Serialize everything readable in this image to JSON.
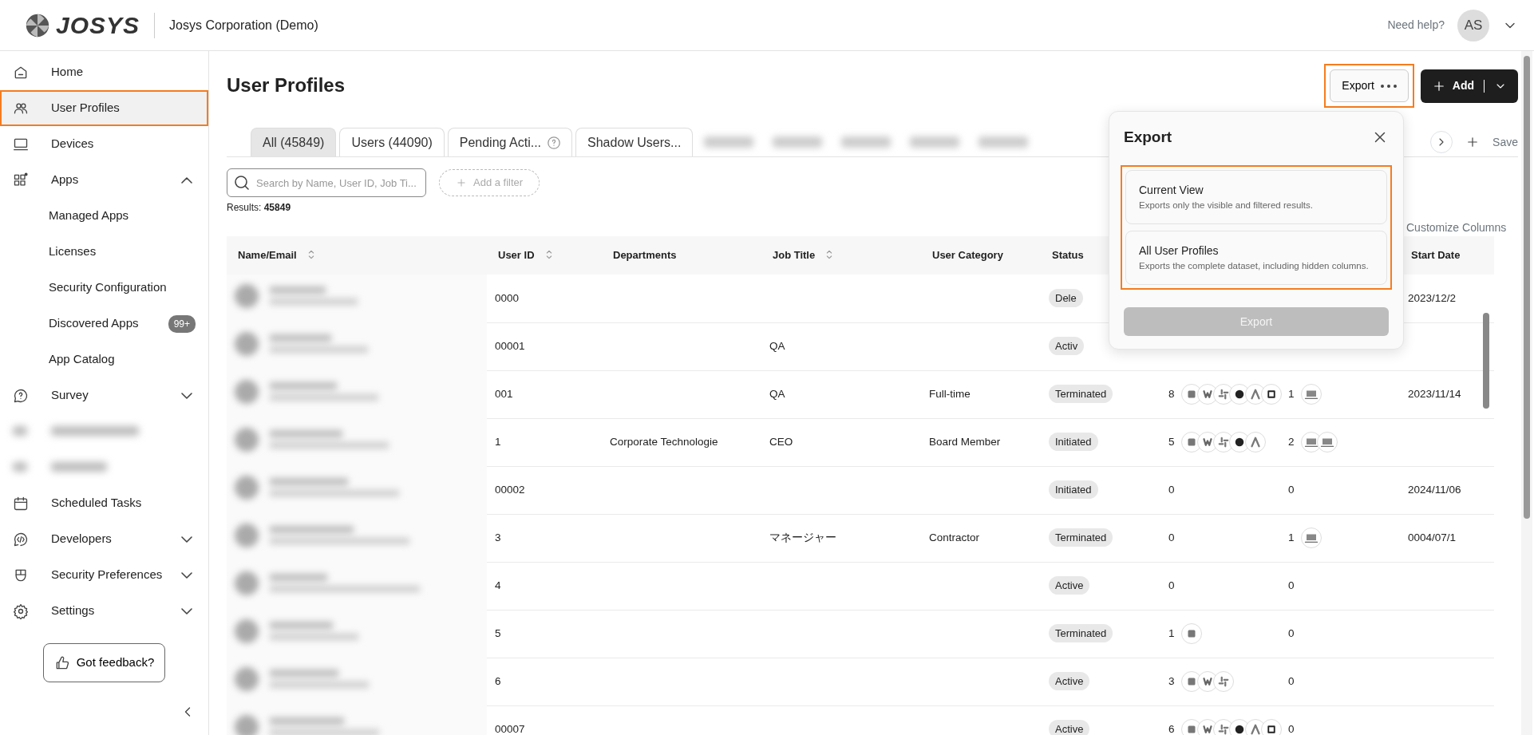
{
  "header": {
    "logo": "JOSYS",
    "organization": "Josys Corporation (Demo)",
    "help": "Need help?",
    "avatar": "AS"
  },
  "sidebar": {
    "items": [
      {
        "label": "Home",
        "selected": false
      },
      {
        "label": "User Profiles",
        "selected": true,
        "highlighted": true
      },
      {
        "label": "Devices",
        "selected": false
      },
      {
        "label": "Apps",
        "selected": false,
        "expanded": true,
        "children": [
          {
            "label": "Managed Apps",
            "selected": false
          },
          {
            "label": "Licenses",
            "selected": false
          },
          {
            "label": "Security Configuration",
            "selected": false
          },
          {
            "label": "Discovered Apps",
            "selected": false,
            "badge": "99+"
          },
          {
            "label": "App Catalog",
            "selected": false
          }
        ]
      },
      {
        "label": "Survey",
        "selected": false,
        "expanded": false
      },
      {
        "kind": "redacted"
      },
      {
        "kind": "redacted"
      },
      {
        "label": "Scheduled Tasks",
        "selected": false
      },
      {
        "label": "Developers",
        "selected": false,
        "expanded": false
      },
      {
        "label": "Security Preferences",
        "selected": false,
        "expanded": false
      },
      {
        "label": "Settings",
        "selected": false,
        "expanded": false
      }
    ],
    "feedback": "Got feedback?"
  },
  "page": {
    "title": "User Profiles",
    "export_button": {
      "label": "Export",
      "highlighted": true
    },
    "add_button": "Add"
  },
  "tabs": [
    {
      "kind": "tab",
      "label": "All (45849)",
      "selected": true
    },
    {
      "kind": "tab",
      "label": "Users (44090)",
      "selected": false
    },
    {
      "kind": "tab",
      "label": "Pending Acti...",
      "selected": false,
      "help": true
    },
    {
      "kind": "tab",
      "label": "Shadow Users...",
      "selected": false
    },
    {
      "kind": "redacted"
    },
    {
      "kind": "redacted"
    },
    {
      "kind": "redacted"
    },
    {
      "kind": "redacted"
    },
    {
      "kind": "redacted"
    }
  ],
  "tab_actions": {
    "save": "Save"
  },
  "search": {
    "placeholder": "Search by Name, User ID, Job Ti..."
  },
  "filter": "Add a filter",
  "results": "Results: **45849**",
  "customize": "Customize Columns",
  "table": {
    "columns": [
      {
        "label": "Name/Email",
        "sortable": true
      },
      {
        "label": "User ID",
        "sortable": true
      },
      {
        "label": "Departments",
        "sortable": false
      },
      {
        "label": "Job Title",
        "sortable": true
      },
      {
        "label": "User Category",
        "sortable": false
      },
      {
        "label": "Status",
        "sortable": false
      },
      {},
      {},
      {
        "label": "Start Date",
        "sortable": false
      }
    ],
    "rows": [
      {
        "user_id": "0000",
        "status": "Dele",
        "start_date": "2023/12/2"
      },
      {
        "user_id": "00001",
        "job_title": "QA",
        "status": "Activ"
      },
      {
        "user_id": "001",
        "job_title": "QA",
        "category": "Full-time",
        "status": "Terminated",
        "apps": "8",
        "devices": "1",
        "start_date": "2023/11/14"
      },
      {
        "user_id": "1",
        "department": "Corporate Technologie",
        "job_title": "CEO",
        "category": "Board Member",
        "status": "Initiated",
        "apps": "5",
        "devices": "2"
      },
      {
        "user_id": "00002",
        "status": "Initiated",
        "apps": "0",
        "devices": "0",
        "start_date": "2024/11/06"
      },
      {
        "user_id": "3",
        "job_title": "マネージャー",
        "category": "Contractor",
        "status": "Terminated",
        "apps": "0",
        "devices": "1",
        "start_date": "0004/07/1"
      },
      {
        "user_id": "4",
        "status": "Active",
        "apps": "0",
        "devices": "0"
      },
      {
        "user_id": "5",
        "status": "Terminated",
        "apps": "1",
        "devices": "0"
      },
      {
        "user_id": "6",
        "status": "Active",
        "apps": "3",
        "devices": "0"
      },
      {
        "user_id": "00007",
        "status": "Active",
        "apps": "6",
        "devices": "0"
      }
    ]
  },
  "export_popover": {
    "title": "Export",
    "highlighted": true,
    "options": [
      {
        "title": "Current View",
        "description": "Exports only the visible and filtered results.",
        "selected": false
      },
      {
        "title": "All User Profiles",
        "description": "Exports the complete dataset, including hidden columns.",
        "selected": false
      }
    ],
    "button": {
      "label": "Export",
      "disabled": true
    }
  }
}
